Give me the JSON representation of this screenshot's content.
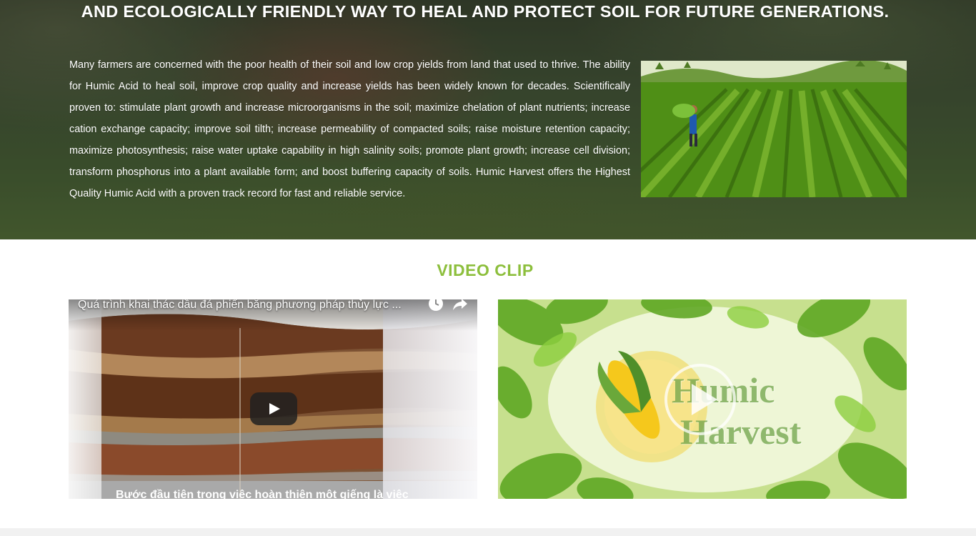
{
  "hero": {
    "title": "AND ECOLOGICALLY FRIENDLY WAY TO HEAL AND PROTECT SOIL FOR  FUTURE GENERATIONS.",
    "body": "Many farmers are concerned with the poor health of their soil and low crop yields from land that used to thrive. The ability for Humic Acid to heal soil, improve crop quality and increase yields has been widely known for decades. Scientifically proven to: stimulate plant growth and increase microorganisms in the soil; maximize chelation of plant nutrients; increase cation exchange capacity; improve soil tilth; increase permeability of compacted soils; raise moisture retention capacity; maximize photosynthesis; raise water uptake capability in high salinity soils; promote plant growth; increase cell division; transform phosphorus into a plant available form; and boost buffering capacity of soils. Humic Harvest offers the Highest Quality Humic Acid with a proven track record for fast and reliable service.",
    "photo_icon": "farm-field-photo"
  },
  "video_section": {
    "heading": "VIDEO CLIP",
    "heading_color": "#8dbf3d",
    "videos": [
      {
        "title": "Quá trình khai thác dầu đá phiến bằng phương pháp thủy lực ...",
        "caption": "Bước đầu tiên trong việc hoàn thiện một giếng là việc",
        "watch_later_icon": "clock-icon",
        "share_icon": "share-icon",
        "play_icon": "youtube-play-icon"
      },
      {
        "logo_line1": "Humic",
        "logo_line2": "Harvest",
        "play_icon": "play-circle-icon"
      }
    ]
  }
}
